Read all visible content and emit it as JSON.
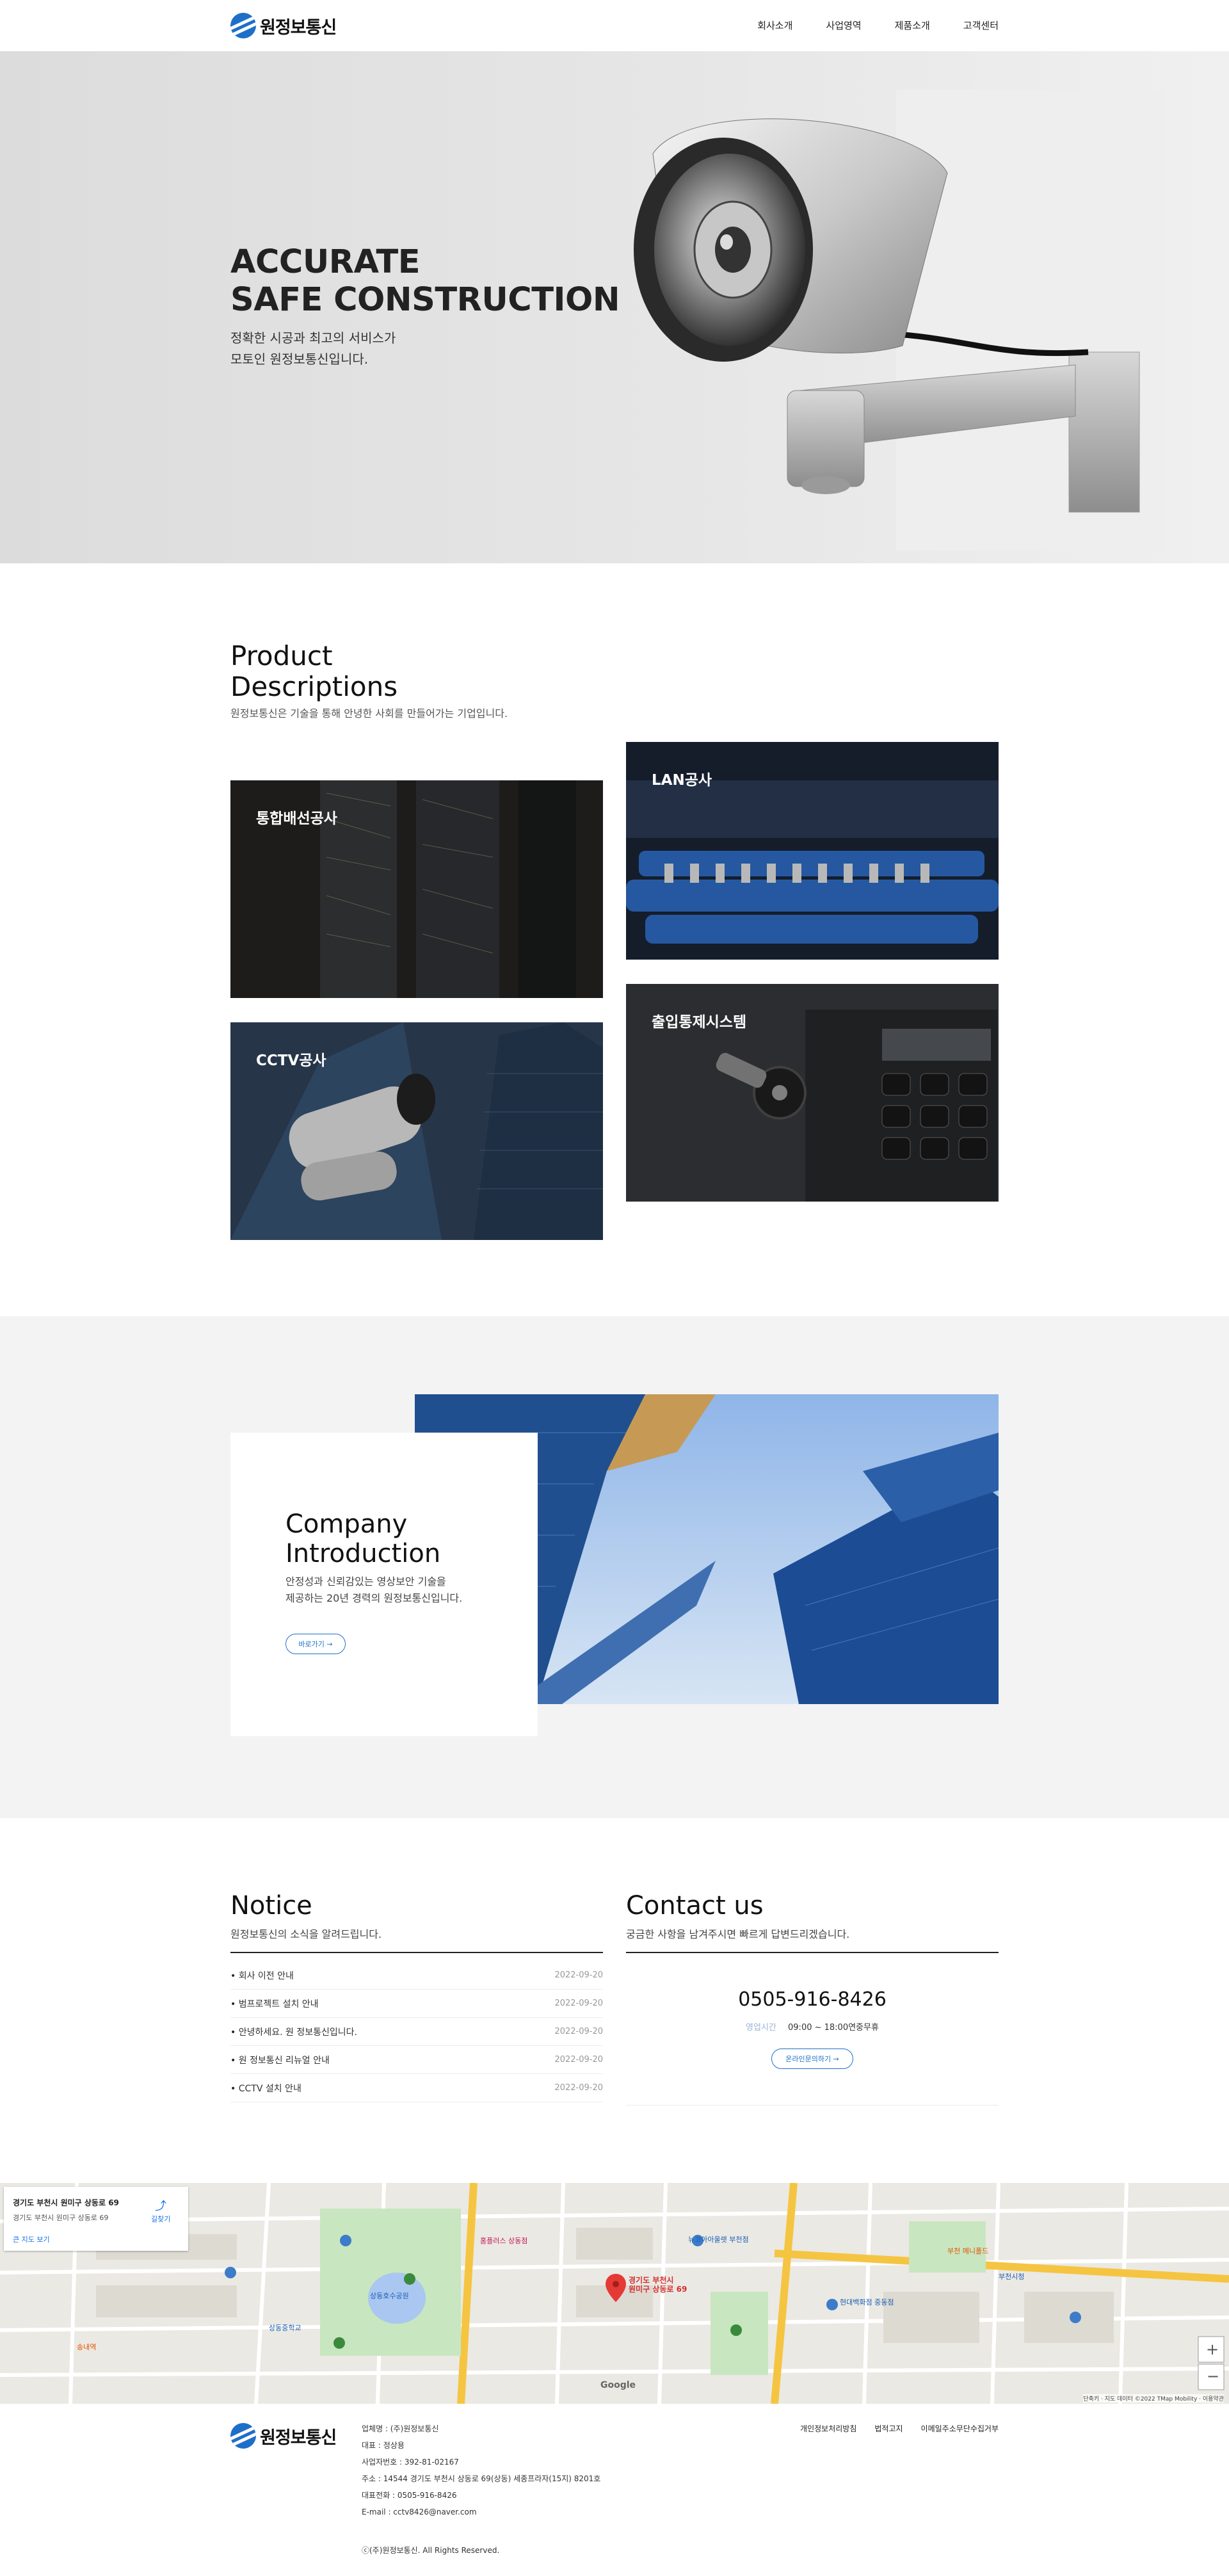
{
  "header": {
    "logo_text": "원정보통신",
    "nav": [
      "회사소개",
      "사업영역",
      "제품소개",
      "고객센터"
    ]
  },
  "hero": {
    "title_line1": "ACCURATE",
    "title_line2": "SAFE CONSTRUCTION",
    "sub_line1": "정확한 시공과 최고의 서비스가",
    "sub_line2": "모토인 원정보통신입니다."
  },
  "product": {
    "title_line1": "Product",
    "title_line2": "Descriptions",
    "desc": "원정보통신은 기술을 통해 안녕한 사회를 만들어가는 기업입니다.",
    "cards": [
      "통합배선공사",
      "LAN공사",
      "CCTV공사",
      "출입통제시스템"
    ]
  },
  "company": {
    "title_line1": "Company",
    "title_line2": "Introduction",
    "desc_line1": "안정성과 신뢰감있는 영상보안 기술을",
    "desc_line2": "제공하는 20년 경력의 원정보통신입니다.",
    "button": "바로가기 →"
  },
  "notice": {
    "title": "Notice",
    "desc": "원정보통신의 소식을 알려드립니다.",
    "items": [
      {
        "title": "회사 이전 안내",
        "date": "2022-09-20"
      },
      {
        "title": "범프로젝트 설치 안내",
        "date": "2022-09-20"
      },
      {
        "title": "안녕하세요. 원 정보통신입니다.",
        "date": "2022-09-20"
      },
      {
        "title": "원 정보통신 리뉴얼 안내",
        "date": "2022-09-20"
      },
      {
        "title": "CCTV 설치 안내",
        "date": "2022-09-20"
      }
    ]
  },
  "contact": {
    "title": "Contact us",
    "desc": "궁금한 사항을 남겨주시면 빠르게 답변드리겠습니다.",
    "phone": "0505-916-8426",
    "hours_label": "영업시간",
    "hours_value": "09:00 ~ 18:00연중무휴",
    "button": "온라인문의하기 →"
  },
  "map": {
    "card_title": "경기도 부천시 원미구 상동로 69",
    "card_sub": "경기도 부천시 원미구 상동로 69",
    "card_link": "큰 지도 보기",
    "directions": "길찾기",
    "marker_line1": "경기도 부천시",
    "marker_line2": "원미구 상동로 69",
    "places": [
      "상동호수공원",
      "뉴코아아울렛 부천점",
      "현대백화점 중동점",
      "부천시청",
      "홈플러스 상동점",
      "상동중학교",
      "송내역",
      "부천 메니폴드"
    ],
    "attribution": "단축키 · 지도 데이터 ©2022 TMap Mobility · 이용약관",
    "google": "Google"
  },
  "footer": {
    "logo_text": "원정보통신",
    "info": [
      "업체명 : (주)원정보통신",
      "대표 : 정상용",
      "사업자번호 : 392-81-02167",
      "주소 : 14544 경기도 부천시 상동로 69(상동) 세종프라자(15지) 8201호",
      "대표전화 : 0505-916-8426",
      "E-mail : cctv8426@naver.com"
    ],
    "links": [
      "개인정보처리방침",
      "법적고지",
      "이메일주소무단수집거부"
    ],
    "copyright": "ⓒ(주)원정보통신. All Rights Reserved."
  },
  "colors": {
    "accent": "#1e6fc8",
    "hero_bg": "#e4e4e4",
    "company_bg": "#f3f3f3"
  }
}
